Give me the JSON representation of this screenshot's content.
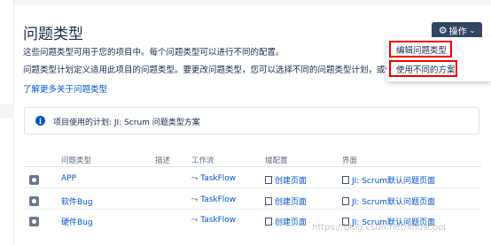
{
  "page": {
    "title": "问题类型",
    "description_line1": "这些问题类型可用于您的项目中。每个问题类型可以进行不同的配置。",
    "description_line2": "问题类型计划定义适用此项目的问题类型。要更改问题类型，您可以选择不同的问题类型计划，或修改",
    "learn_more": "了解更多关于问题类型"
  },
  "actions": {
    "label": "操作",
    "icon": "gear-icon",
    "menu": {
      "edit_issue_types": "编辑问题类型",
      "use_different_scheme": "使用不同的方案"
    }
  },
  "info": {
    "text": "项目使用的计划: JI: Scrum 问题类型方案"
  },
  "table": {
    "headers": {
      "type": "问题类型",
      "description": "描述",
      "workflow": "工作流",
      "field_config": "域配置",
      "screens": "界面"
    },
    "rows": [
      {
        "name": "APP",
        "workflow": "TaskFlow",
        "field_config": "创建页面",
        "screens": "JI: Scrum默认问题页面"
      },
      {
        "name": "软件Bug",
        "workflow": "TaskFlow",
        "field_config": "创建页面",
        "screens": "JI: Scrum默认问题页面"
      },
      {
        "name": "硬件Bug",
        "workflow": "TaskFlow",
        "field_config": "创建页面",
        "screens": "JI: Scrum默认问题页面"
      }
    ]
  },
  "watermark": "https://blog.csdn.net/linuscool"
}
